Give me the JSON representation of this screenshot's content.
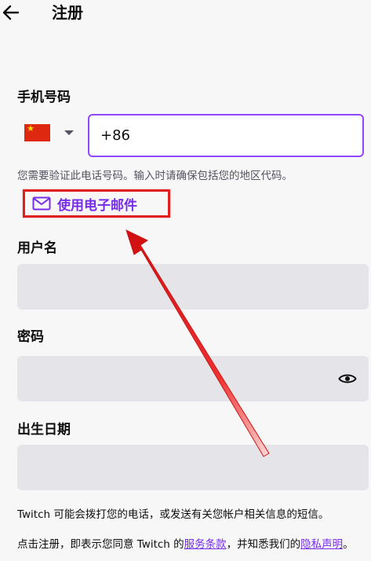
{
  "header": {
    "title": "注册",
    "back_icon": "arrow-left-icon"
  },
  "phone": {
    "label": "手机号码",
    "country_flag": "china-flag-icon",
    "value": "+86",
    "hint": "您需要验证此电话号码。输入时请确保包括您的地区代码。",
    "use_email_label": "使用电子邮件",
    "email_icon": "mail-icon"
  },
  "username": {
    "label": "用户名",
    "value": ""
  },
  "password": {
    "label": "密码",
    "value": "",
    "toggle_icon": "eye-icon"
  },
  "birthdate": {
    "label": "出生日期",
    "value": ""
  },
  "footer": {
    "sms_notice": "Twitch 可能会拨打您的电话，或发送有关您帐户相关信息的短信。",
    "terms_prefix": "点击注册，即表示您同意 Twitch 的",
    "terms_link": "服务条款",
    "terms_middle": "，并知悉我们的",
    "privacy_link": "隐私声明",
    "terms_suffix": "。"
  },
  "colors": {
    "accent": "#9147ff",
    "link": "#772ce8",
    "annotation": "#e02020",
    "field_bg": "#e5e5e9",
    "page_bg": "#f7f7f8"
  }
}
